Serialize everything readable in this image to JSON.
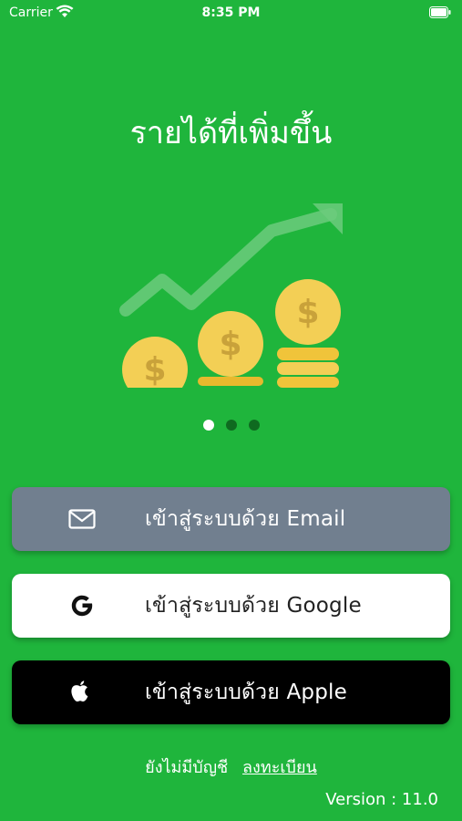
{
  "status_bar": {
    "carrier": "Carrier",
    "time": "8:35 PM",
    "wifi_icon": "wifi-icon",
    "battery_icon": "battery-icon"
  },
  "onboarding": {
    "headline": "รายได้ที่เพิ่มขึ้น",
    "illustration": "growth-coins-illustration",
    "page_count": 3,
    "active_page": 1
  },
  "buttons": {
    "email": {
      "label": "เข้าสู่ระบบด้วย Email",
      "icon": "mail-icon",
      "bg": "#717f8f"
    },
    "google": {
      "label": "เข้าสู่ระบบด้วย Google",
      "icon": "google-icon",
      "bg": "#ffffff"
    },
    "apple": {
      "label": "เข้าสู่ระบบด้วย Apple",
      "icon": "apple-icon",
      "bg": "#000000"
    }
  },
  "footer": {
    "no_account": "ยังไม่มีบัญชี",
    "register": "ลงทะเบียน",
    "version": "Version : 11.0"
  },
  "colors": {
    "background": "#1fb53c",
    "coin": "#f3cf55",
    "coin_symbol": "#c9a23a",
    "pager_inactive": "#0f6a20"
  }
}
